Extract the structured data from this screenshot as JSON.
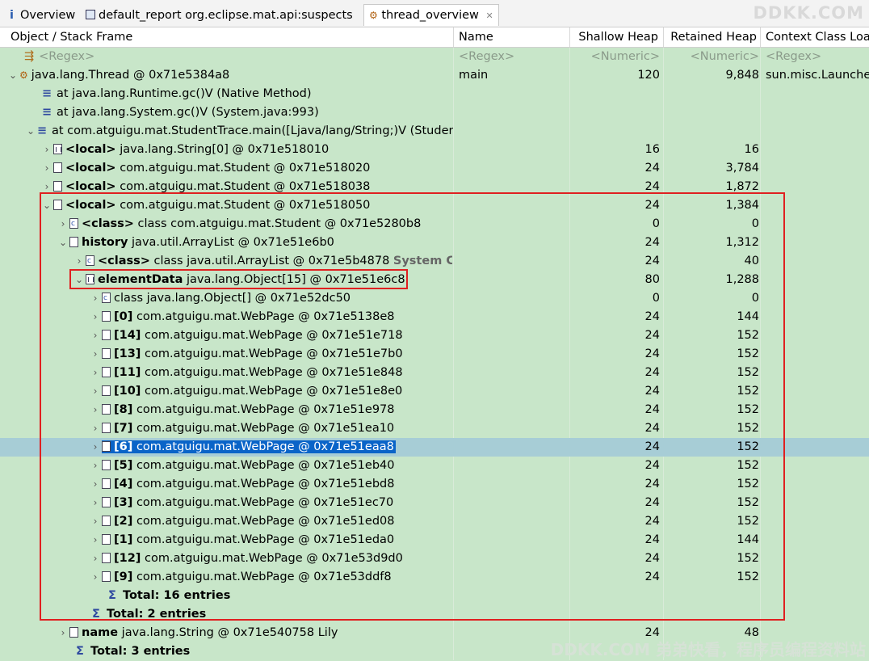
{
  "tabs": [
    {
      "icon": "info-icon",
      "label": "Overview"
    },
    {
      "icon": "report-icon",
      "label": "default_report  org.eclipse.mat.api:suspects"
    },
    {
      "icon": "thread-icon",
      "label": "thread_overview"
    }
  ],
  "top_watermark": "DDKK.COM",
  "bottom_watermark": "DDKK.COM 弟弟快看，程序员编程资料站",
  "columns": [
    "Object / Stack Frame",
    "Name",
    "Shallow Heap",
    "Retained Heap",
    "Context Class Loa"
  ],
  "filter": {
    "obj": "<Regex>",
    "name": "<Regex>",
    "shallow": "<Numeric>",
    "retained": "<Numeric>",
    "ctx": "<Regex>"
  },
  "rows": [
    {
      "prefix": "",
      "text": "java.lang.Thread @ 0x71e5384a8",
      "name": "main",
      "shallow": "120",
      "retained": "9,848",
      "ctx": "sun.misc.Launcher"
    },
    {
      "prefix": "",
      "text": "at java.lang.Runtime.gc()V (Native Method)",
      "name": "",
      "shallow": "",
      "retained": "",
      "ctx": ""
    },
    {
      "prefix": "",
      "text": "at java.lang.System.gc()V (System.java:993)",
      "name": "",
      "shallow": "",
      "retained": "",
      "ctx": ""
    },
    {
      "prefix": "",
      "text": "at com.atguigu.mat.StudentTrace.main([Ljava/lang/String;)V (Studen",
      "name": "",
      "shallow": "",
      "retained": "",
      "ctx": ""
    },
    {
      "prefix": "<local>",
      "text": "java.lang.String[0] @ 0x71e518010",
      "name": "",
      "shallow": "16",
      "retained": "16",
      "ctx": ""
    },
    {
      "prefix": "<local>",
      "text": "com.atguigu.mat.Student @ 0x71e518020",
      "name": "",
      "shallow": "24",
      "retained": "3,784",
      "ctx": ""
    },
    {
      "prefix": "<local>",
      "text": "com.atguigu.mat.Student @ 0x71e518038",
      "name": "",
      "shallow": "24",
      "retained": "1,872",
      "ctx": ""
    },
    {
      "prefix": "<local>",
      "text": "com.atguigu.mat.Student @ 0x71e518050",
      "name": "",
      "shallow": "24",
      "retained": "1,384",
      "ctx": ""
    },
    {
      "prefix": "<class>",
      "text": "class com.atguigu.mat.Student @ 0x71e5280b8",
      "name": "",
      "shallow": "0",
      "retained": "0",
      "ctx": ""
    },
    {
      "prefix": "history",
      "text": "java.util.ArrayList @ 0x71e51e6b0",
      "name": "",
      "shallow": "24",
      "retained": "1,312",
      "ctx": ""
    },
    {
      "prefix": "<class>",
      "text": "class java.util.ArrayList @ 0x71e5b4878",
      "suffix": "System Cla",
      "name": "",
      "shallow": "24",
      "retained": "40",
      "ctx": ""
    },
    {
      "prefix": "elementData",
      "text": "java.lang.Object[15] @ 0x71e51e6c8",
      "name": "",
      "shallow": "80",
      "retained": "1,288",
      "ctx": ""
    },
    {
      "prefix": "",
      "text": "class java.lang.Object[] @ 0x71e52dc50",
      "name": "",
      "shallow": "0",
      "retained": "0",
      "ctx": ""
    },
    {
      "prefix": "[0]",
      "text": "com.atguigu.mat.WebPage @ 0x71e5138e8",
      "name": "",
      "shallow": "24",
      "retained": "144",
      "ctx": ""
    },
    {
      "prefix": "[14]",
      "text": "com.atguigu.mat.WebPage @ 0x71e51e718",
      "name": "",
      "shallow": "24",
      "retained": "152",
      "ctx": ""
    },
    {
      "prefix": "[13]",
      "text": "com.atguigu.mat.WebPage @ 0x71e51e7b0",
      "name": "",
      "shallow": "24",
      "retained": "152",
      "ctx": ""
    },
    {
      "prefix": "[11]",
      "text": "com.atguigu.mat.WebPage @ 0x71e51e848",
      "name": "",
      "shallow": "24",
      "retained": "152",
      "ctx": ""
    },
    {
      "prefix": "[10]",
      "text": "com.atguigu.mat.WebPage @ 0x71e51e8e0",
      "name": "",
      "shallow": "24",
      "retained": "152",
      "ctx": ""
    },
    {
      "prefix": "[8]",
      "text": "com.atguigu.mat.WebPage @ 0x71e51e978",
      "name": "",
      "shallow": "24",
      "retained": "152",
      "ctx": ""
    },
    {
      "prefix": "[7]",
      "text": "com.atguigu.mat.WebPage @ 0x71e51ea10",
      "name": "",
      "shallow": "24",
      "retained": "152",
      "ctx": ""
    },
    {
      "prefix": "[6]",
      "text": "com.atguigu.mat.WebPage @ 0x71e51eaa8",
      "name": "",
      "shallow": "24",
      "retained": "152",
      "ctx": ""
    },
    {
      "prefix": "[5]",
      "text": "com.atguigu.mat.WebPage @ 0x71e51eb40",
      "name": "",
      "shallow": "24",
      "retained": "152",
      "ctx": ""
    },
    {
      "prefix": "[4]",
      "text": "com.atguigu.mat.WebPage @ 0x71e51ebd8",
      "name": "",
      "shallow": "24",
      "retained": "152",
      "ctx": ""
    },
    {
      "prefix": "[3]",
      "text": "com.atguigu.mat.WebPage @ 0x71e51ec70",
      "name": "",
      "shallow": "24",
      "retained": "152",
      "ctx": ""
    },
    {
      "prefix": "[2]",
      "text": "com.atguigu.mat.WebPage @ 0x71e51ed08",
      "name": "",
      "shallow": "24",
      "retained": "152",
      "ctx": ""
    },
    {
      "prefix": "[1]",
      "text": "com.atguigu.mat.WebPage @ 0x71e51eda0",
      "name": "",
      "shallow": "24",
      "retained": "144",
      "ctx": ""
    },
    {
      "prefix": "[12]",
      "text": "com.atguigu.mat.WebPage @ 0x71e53d9d0",
      "name": "",
      "shallow": "24",
      "retained": "152",
      "ctx": ""
    },
    {
      "prefix": "[9]",
      "text": "com.atguigu.mat.WebPage @ 0x71e53ddf8",
      "name": "",
      "shallow": "24",
      "retained": "152",
      "ctx": ""
    },
    {
      "prefix": "",
      "text": "Total: 16 entries",
      "name": "",
      "shallow": "",
      "retained": "",
      "ctx": ""
    },
    {
      "prefix": "",
      "text": "Total: 2 entries",
      "name": "",
      "shallow": "",
      "retained": "",
      "ctx": ""
    },
    {
      "prefix": "name",
      "text": "java.lang.String @ 0x71e540758  Lily",
      "name": "",
      "shallow": "24",
      "retained": "48",
      "ctx": ""
    },
    {
      "prefix": "",
      "text": "Total: 3 entries",
      "name": "",
      "shallow": "",
      "retained": "",
      "ctx": ""
    }
  ]
}
